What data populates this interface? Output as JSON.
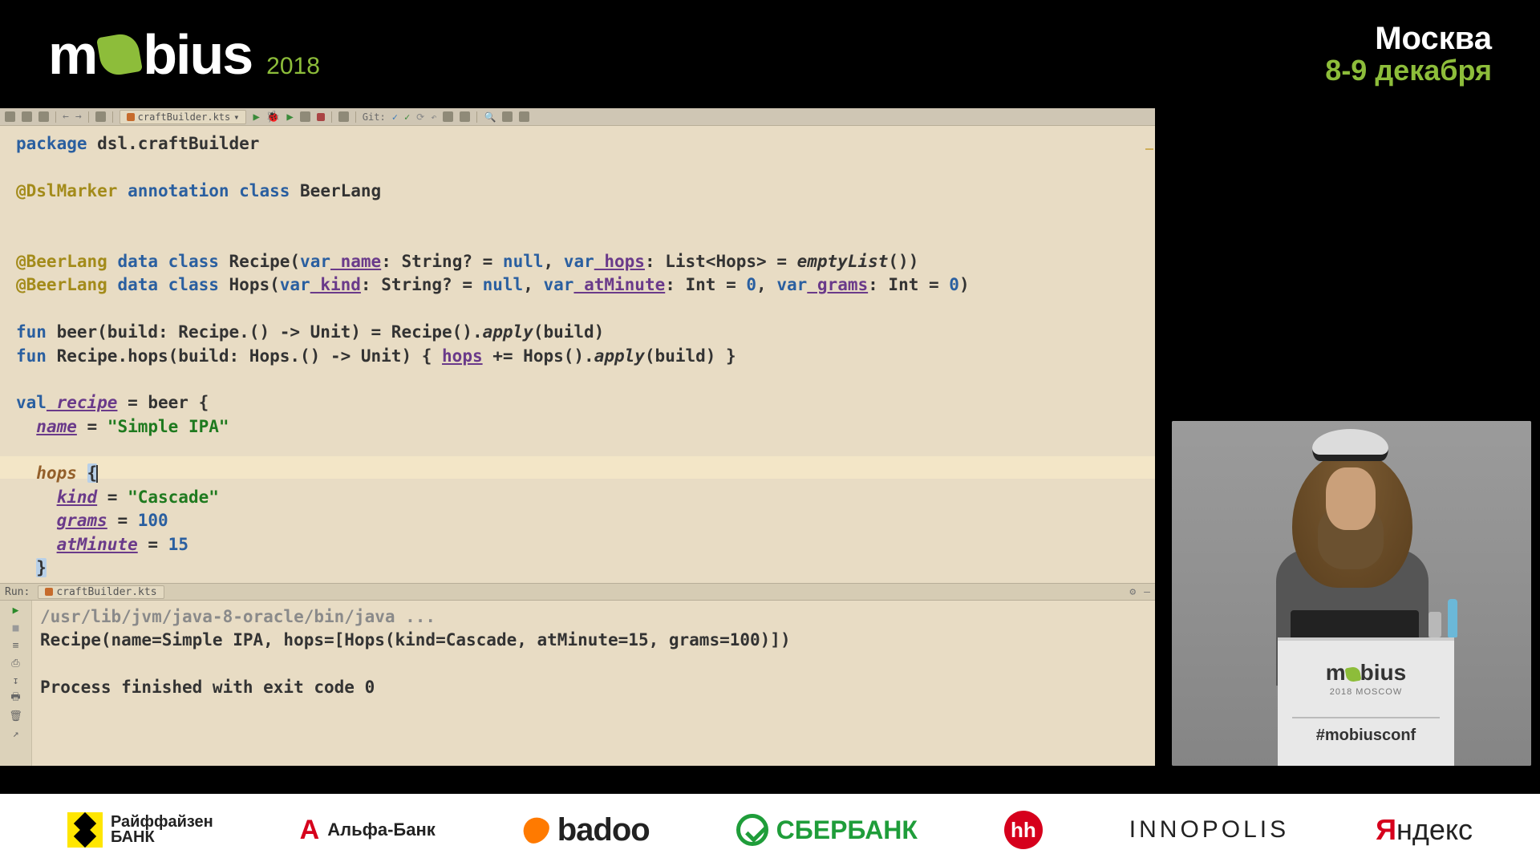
{
  "conference": {
    "name_prefix": "m",
    "name_suffix": "bius",
    "year": "2018",
    "city": "Москва",
    "dates": "8-9 декабря"
  },
  "ide": {
    "open_file": "craftBuilder.kts",
    "git_label": "Git:",
    "code": {
      "l1_kw": "package",
      "l1_rest": " dsl.craftBuilder",
      "l3_ann": "@DslMarker",
      "l3_kw": "annotation class",
      "l3_name": " BeerLang",
      "l5_ann": "@BeerLang",
      "l5_kw": "data class",
      "l5a": " Recipe(",
      "l5_kw2": "var",
      "l5_name": " name",
      "l5b": ": String? = ",
      "l5_kw3": "null",
      "l5c": ", ",
      "l5_kw4": "var",
      "l5_hops": " hops",
      "l5d": ": List<Hops> = ",
      "l5_empty": "emptyList",
      "l5e": "())",
      "l6_ann": "@BeerLang",
      "l6_kw": "data class",
      "l6a": " Hops(",
      "l6_kw2": "var",
      "l6_kind": " kind",
      "l6b": ": String? = ",
      "l6_kw3": "null",
      "l6c": ", ",
      "l6_kw4": "var",
      "l6_atmin": " atMinute",
      "l6d": ": Int = ",
      "l6_n1": "0",
      "l6e": ", ",
      "l6_kw5": "var",
      "l6_grams": " grams",
      "l6f": ": Int = ",
      "l6_n2": "0",
      "l6g": ")",
      "l8_kw": "fun",
      "l8a": " beer(build: Recipe.() -> Unit) = Recipe().",
      "l8_apply": "apply",
      "l8b": "(build)",
      "l9_kw": "fun",
      "l9a": " Recipe.hops(build: Hops.() -> Unit) { ",
      "l9_hops": "hops",
      "l9b": " += Hops().",
      "l9_apply": "apply",
      "l9c": "(build) }",
      "l11_kw": "val",
      "l11_rec": " recipe",
      "l11a": " = beer {",
      "l12_name": "name",
      "l12a": " = ",
      "l12_str": "\"Simple IPA\"",
      "l14_hops": "hops",
      "l14a": " ",
      "l14_brace": "{",
      "l15_kind": "kind",
      "l15a": " = ",
      "l15_str": "\"Cascade\"",
      "l16_grams": "grams",
      "l16a": " = ",
      "l16_n": "100",
      "l17_atmin": "atMinute",
      "l17a": " = ",
      "l17_n": "15",
      "l18_brace": "}"
    },
    "run": {
      "label": "Run:",
      "tab": "craftBuilder.kts",
      "out1": "/usr/lib/jvm/java-8-oracle/bin/java ...",
      "out2": "Recipe(name=Simple IPA, hops=[Hops(kind=Cascade, atMinute=15, grams=100)])",
      "out3": "Process finished with exit code 0"
    }
  },
  "podium": {
    "brand_prefix": "m",
    "brand_suffix": "bius",
    "sub": "2018 MOSCOW",
    "hashtag": "#mobiusconf"
  },
  "sponsors": {
    "raif1": "Райффайзен",
    "raif2": "БАНК",
    "alfa": "Альфа-Банк",
    "badoo": "badoo",
    "sber": "СБЕРБАНК",
    "hh": "hh",
    "inno": "INNOPOLIS",
    "yandex_y": "Я",
    "yandex_rest": "ндекс"
  }
}
